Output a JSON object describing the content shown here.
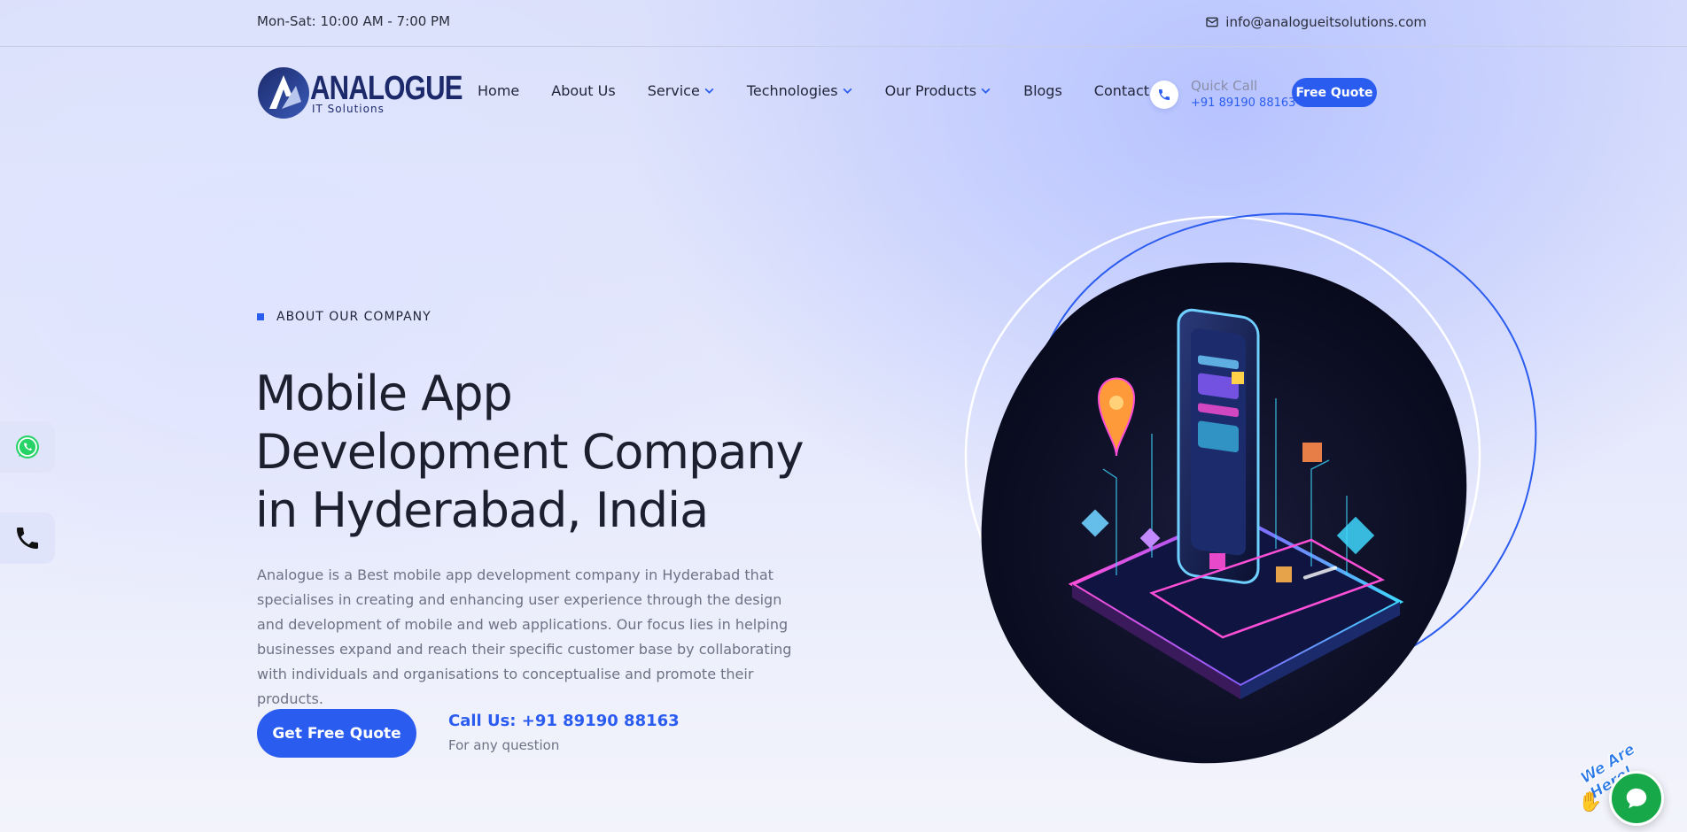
{
  "topbar": {
    "hours": "Mon-Sat: 10:00 AM - 7:00 PM",
    "email": "info@analogueitsolutions.com"
  },
  "logo": {
    "brand": "ANALOGUE",
    "tagline": "IT Solutions"
  },
  "nav": {
    "items": [
      {
        "label": "Home",
        "dropdown": false
      },
      {
        "label": "About Us",
        "dropdown": false
      },
      {
        "label": "Service",
        "dropdown": true
      },
      {
        "label": "Technologies",
        "dropdown": true
      },
      {
        "label": "Our Products",
        "dropdown": true
      },
      {
        "label": "Blogs",
        "dropdown": false
      },
      {
        "label": "Contact",
        "dropdown": false
      }
    ]
  },
  "quick_call": {
    "label": "Quick Call",
    "number": "+91 89190 88163"
  },
  "header_button": "Free Quote",
  "hero": {
    "eyebrow": "ABOUT OUR COMPANY",
    "title": "Mobile App Development Company in Hyderabad, India",
    "description": "Analogue is a Best mobile app development company in Hyderabad that specialises in creating and enhancing user experience through the design and development of mobile and web applications. Our focus lies in helping businesses expand and reach their specific customer base by collaborating with individuals and organisations to conceptualise and promote their products.",
    "cta_label": "Get Free Quote",
    "call_label": "Call Us: +91 89190 88163",
    "call_sub": "For any question"
  },
  "side_buttons": {
    "whatsapp_icon": "whatsapp-icon",
    "phone_icon": "phone-icon"
  },
  "chat_widget": {
    "tag": "We Are Here!",
    "icon": "chat-bubble-icon"
  },
  "colors": {
    "accent": "#2b5cf0",
    "brand_navy": "#1c2a6b",
    "chat_green": "#17a84a"
  }
}
